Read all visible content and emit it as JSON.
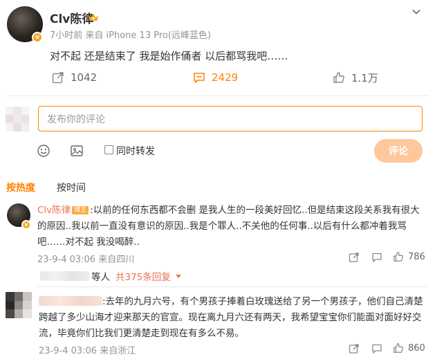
{
  "post": {
    "author": "Clv陈律",
    "meta": "7小时前 来自 iPhone 13 Pro(远峰蓝色)",
    "text": "对不起 还是结束了 我是始作俑者 以后都骂我吧……",
    "repost_count": "1042",
    "comment_count": "2429",
    "like_count": "1.1万"
  },
  "composer": {
    "placeholder": "发布你的评论",
    "also_repost_label": "同时转发",
    "submit_label": "评论"
  },
  "sort": {
    "by_hot": "按热度",
    "by_time": "按时间"
  },
  "comments": [
    {
      "author": "Clv陈律",
      "badge": "博主",
      "text": ":以前的任何东西都不会删 是我人生的一段美好回忆..但是结束这段关系我有很大的原因..我以前一直没有意识的原因..我是个罪人..不关他的任何事..以后有什么都冲着我骂吧……对不起 我没喝醉..",
      "meta": "23-9-4 03:06 来自四川",
      "likes": "786",
      "reply_suffix": "等人",
      "reply_link": "共375条回复"
    },
    {
      "text": ":去年的九月六号，有个男孩子捧着白玫瑰送给了另一个男孩子，他们自己清楚跨越了多少山海才迎来那天的官宣。现在离九月六还有两天，我希望宝宝你们能面对面好好交流，毕竟你们比我们更清楚走到现在有多么不易。",
      "meta": "23-9-4 03:06 来自浙江",
      "likes": "860"
    }
  ],
  "colors": {
    "accent": "#ff8200",
    "name": "#eb7350",
    "muted": "#939393",
    "submit_disabled": "#ffc79b"
  },
  "icons": [
    "crown-icon",
    "verified-badge-icon",
    "chevron-down-icon",
    "repost-icon",
    "comment-icon",
    "like-icon",
    "emoji-icon",
    "image-icon",
    "share-icon",
    "caret-down-icon"
  ]
}
